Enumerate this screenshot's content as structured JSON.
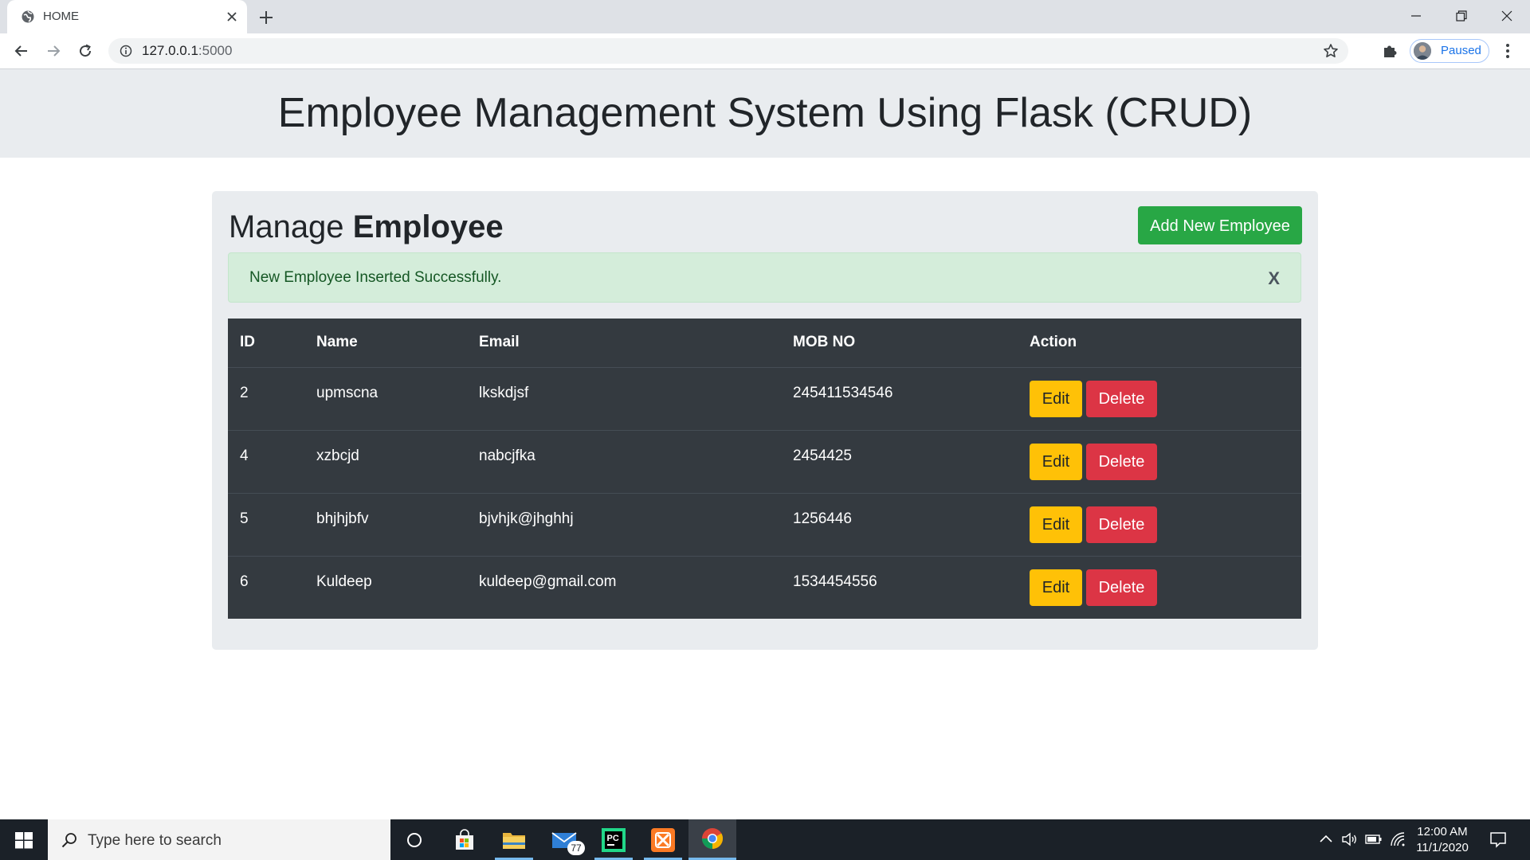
{
  "browser": {
    "tab_title": "HOME",
    "url_host": "127.0.0.1",
    "url_port": ":5000",
    "profile_status": "Paused"
  },
  "page": {
    "header_title": "Employee Management System Using Flask (CRUD)",
    "section_title_prefix": "Manage",
    "section_title_bold": "Employee",
    "add_button": "Add New Employee",
    "alert_message": "New Employee Inserted Successfully.",
    "alert_close": "X"
  },
  "table": {
    "headers": [
      "ID",
      "Name",
      "Email",
      "MOB NO",
      "Action"
    ],
    "rows": [
      {
        "id": "2",
        "name": "upmscna",
        "email": "lkskdjsf",
        "mobile": "245411534546"
      },
      {
        "id": "4",
        "name": "xzbcjd",
        "email": "nabcjfka",
        "mobile": "2454425"
      },
      {
        "id": "5",
        "name": "bhjhjbfv",
        "email": "bjvhjk@jhghhj",
        "mobile": "1256446"
      },
      {
        "id": "6",
        "name": "Kuldeep",
        "email": "kuldeep@gmail.com",
        "mobile": "1534454556"
      }
    ],
    "edit_label": "Edit",
    "delete_label": "Delete"
  },
  "taskbar": {
    "search_placeholder": "Type here to search",
    "mail_badge": "77",
    "time": "12:00 AM",
    "date": "11/1/2020",
    "pinned_icons": [
      "task-view-icon",
      "store-icon",
      "file-explorer-icon",
      "mail-icon",
      "pycharm-icon",
      "xampp-icon",
      "chrome-icon"
    ]
  },
  "colors": {
    "success": "#28a745",
    "warning": "#ffc107",
    "danger": "#dc3545",
    "table_dark": "#343a40",
    "alert_bg": "#d4edda",
    "alert_text": "#155724",
    "light_bg": "#e9ecef"
  }
}
